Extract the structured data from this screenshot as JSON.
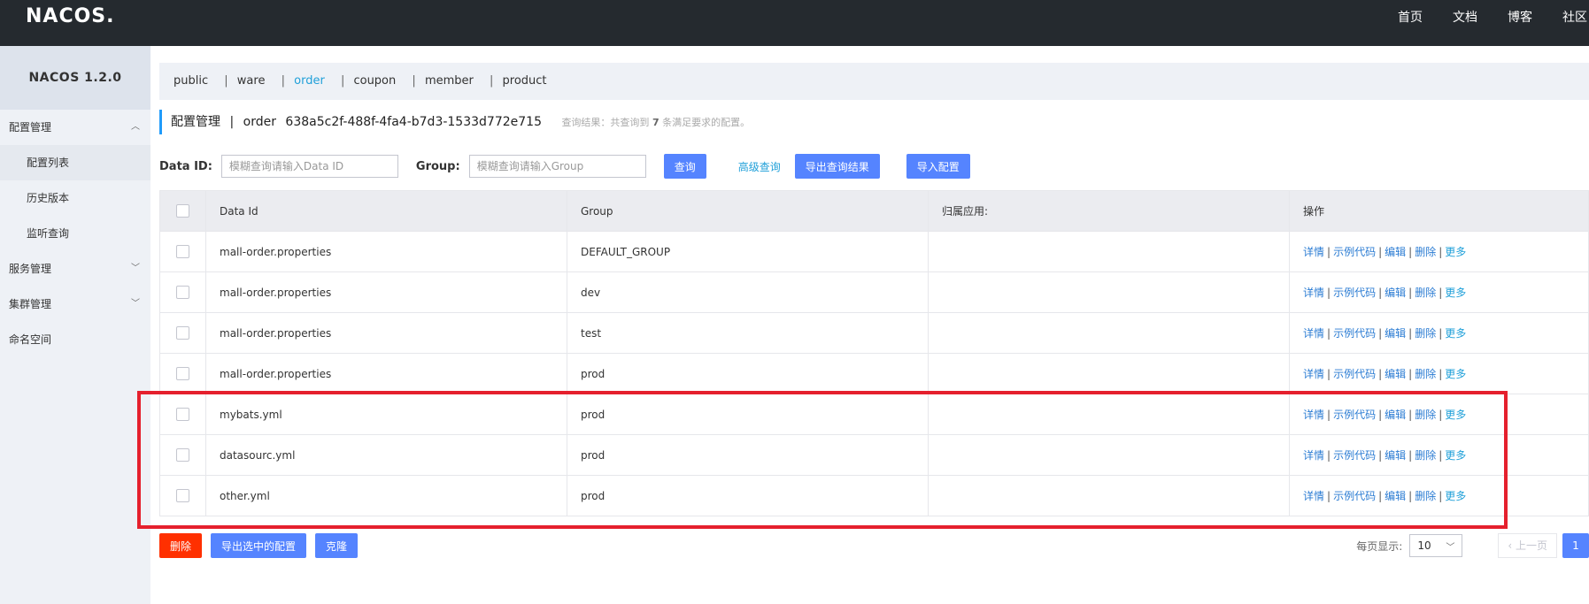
{
  "header": {
    "logo": "NACOS.",
    "nav": [
      "首页",
      "文档",
      "博客",
      "社区"
    ]
  },
  "sidebar": {
    "title": "NACOS 1.2.0",
    "items": [
      {
        "label": "配置管理",
        "expanded": true
      },
      {
        "label": "配置列表",
        "active": true
      },
      {
        "label": "历史版本"
      },
      {
        "label": "监听查询"
      },
      {
        "label": "服务管理"
      },
      {
        "label": "集群管理"
      },
      {
        "label": "命名空间"
      }
    ]
  },
  "namespaces": {
    "items": [
      "public",
      "ware",
      "order",
      "coupon",
      "member",
      "product"
    ],
    "separator": "|",
    "active": "order"
  },
  "page_head": {
    "title": "配置管理",
    "separator": "|",
    "namespace_name": "order",
    "namespace_id": "638a5c2f-488f-4fa4-b7d3-1533d772e715",
    "hint_prefix": "查询结果：共查询到",
    "hint_count": "7",
    "hint_suffix": "条满足要求的配置。"
  },
  "search": {
    "dataid_label": "Data ID:",
    "dataid_placeholder": "模糊查询请输入Data ID",
    "group_label": "Group:",
    "group_placeholder": "模糊查询请输入Group",
    "query_btn": "查询",
    "advanced": "高级查询",
    "export_btn": "导出查询结果",
    "import_btn": "导入配置"
  },
  "table": {
    "headers": [
      "Data Id",
      "Group",
      "归属应用:",
      "操作"
    ],
    "ops": [
      "详情",
      "示例代码",
      "编辑",
      "删除",
      "更多"
    ],
    "op_sep": "|",
    "rows": [
      {
        "data_id": "mall-order.properties",
        "group": "DEFAULT_GROUP",
        "app": ""
      },
      {
        "data_id": "mall-order.properties",
        "group": "dev",
        "app": ""
      },
      {
        "data_id": "mall-order.properties",
        "group": "test",
        "app": ""
      },
      {
        "data_id": "mall-order.properties",
        "group": "prod",
        "app": ""
      },
      {
        "data_id": "mybats.yml",
        "group": "prod",
        "app": ""
      },
      {
        "data_id": "datasourc.yml",
        "group": "prod",
        "app": ""
      },
      {
        "data_id": "other.yml",
        "group": "prod",
        "app": ""
      }
    ]
  },
  "footer": {
    "delete_btn": "删除",
    "export_selected_btn": "导出选中的配置",
    "clone_btn": "克隆",
    "page_size_label": "每页显示:",
    "page_size": "10",
    "prev_label": "上一页",
    "current_page": "1"
  },
  "colors": {
    "topbar": "#252a2f",
    "primary": "#5584ff",
    "danger": "#ff3000",
    "link": "#20a0d9",
    "highlight": "#e5202d"
  }
}
